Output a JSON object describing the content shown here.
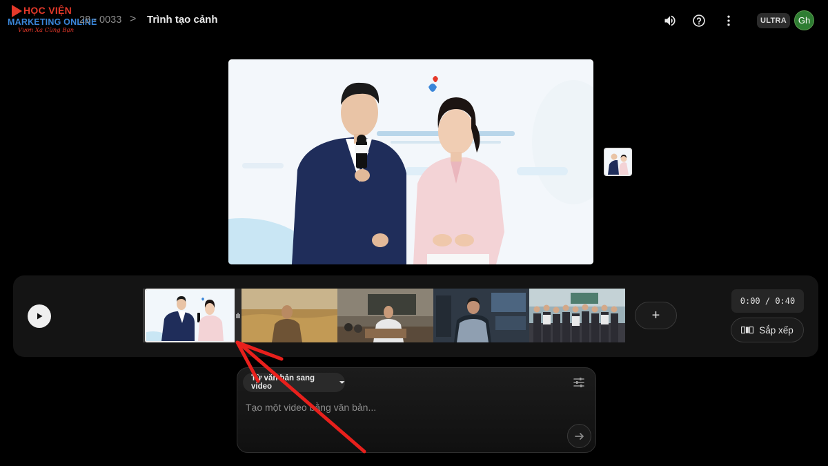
{
  "logo": {
    "line1": "HỌC VIỆN",
    "line2": "MARKETING ONLINE",
    "line3": "Vươn Xa Cùng Bạn",
    "color_red": "#e5392a",
    "color_blue": "#3a86d9"
  },
  "header": {
    "project": "28 - 0033",
    "separator": ">",
    "title": "Trình tạo cảnh",
    "icons": [
      "volume-icon",
      "help-icon",
      "more-vert-icon"
    ],
    "plan_badge": "ULTRA",
    "avatar_initials": "Gh",
    "avatar_color": "#2e7d32"
  },
  "timeline": {
    "clips": [
      {
        "name": "clip-studio-hosts",
        "selected": true
      },
      {
        "name": "clip-wheat-field"
      },
      {
        "name": "clip-office-presenter"
      },
      {
        "name": "clip-control-room"
      },
      {
        "name": "clip-team-group"
      }
    ],
    "add_label": "+",
    "time": "0:00 / 0:40",
    "arrange_label": "Sắp xếp"
  },
  "prompt": {
    "mode_label": "Từ văn bản sang video",
    "placeholder": "Tạo một video bằng văn bản...",
    "value": ""
  },
  "annotation": {
    "arrow_color": "#e8201c"
  }
}
